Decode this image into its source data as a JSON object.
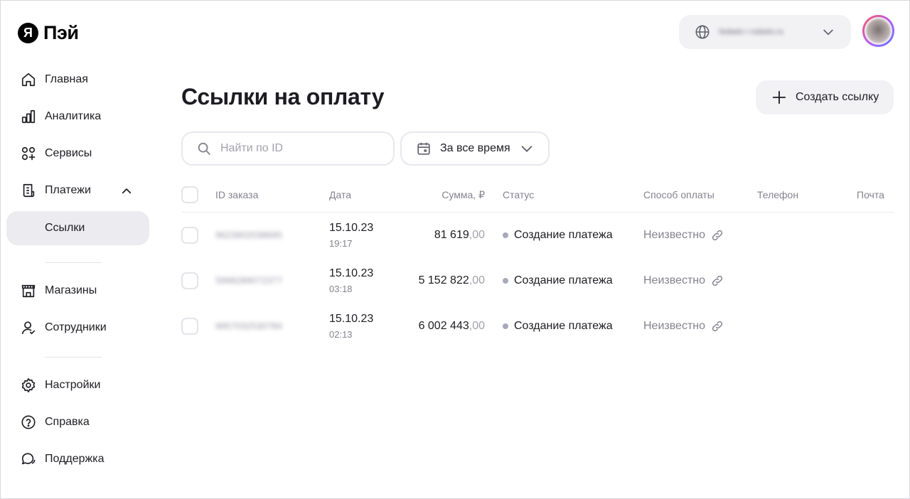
{
  "logo": {
    "mark": "Я",
    "text": "Пэй"
  },
  "sidebar": {
    "items": [
      {
        "label": "Главная",
        "icon": "home-icon"
      },
      {
        "label": "Аналитика",
        "icon": "analytics-icon"
      },
      {
        "label": "Сервисы",
        "icon": "services-icon"
      },
      {
        "label": "Платежи",
        "icon": "payments-icon",
        "expanded": true
      },
      {
        "label": "Ссылки",
        "selected": true
      },
      {
        "label": "Магазины",
        "icon": "shops-icon"
      },
      {
        "label": "Сотрудники",
        "icon": "employees-icon"
      },
      {
        "label": "Настройки",
        "icon": "settings-icon"
      },
      {
        "label": "Справка",
        "icon": "help-icon"
      },
      {
        "label": "Поддержка",
        "icon": "support-icon"
      }
    ]
  },
  "header": {
    "merchant_name": "Nobelo • nobelo.ru",
    "title": "Ссылки на оплату",
    "create_button": "Создать ссылку"
  },
  "filters": {
    "search_placeholder": "Найти по ID",
    "period": "За все время"
  },
  "table": {
    "columns": [
      "ID заказа",
      "Дата",
      "Сумма, ₽",
      "Статус",
      "Способ оплаты",
      "Телефон",
      "Почта"
    ],
    "rows": [
      {
        "order_id": "9623902038695",
        "date": "15.10.23",
        "time": "19:17",
        "amount_main": "81 619",
        "amount_kop": ",00",
        "status": "Создание платежа",
        "method": "Неизвестно",
        "phone": "",
        "email": ""
      },
      {
        "order_id": "5998289072377",
        "date": "15.10.23",
        "time": "03:18",
        "amount_main": "5 152 822",
        "amount_kop": ",00",
        "status": "Создание платежа",
        "method": "Неизвестно",
        "phone": "",
        "email": ""
      },
      {
        "order_id": "9957032530784",
        "date": "15.10.23",
        "time": "02:13",
        "amount_main": "6 002 443",
        "amount_kop": ",00",
        "status": "Создание платежа",
        "method": "Неизвестно",
        "phone": "",
        "email": ""
      }
    ]
  },
  "colors": {
    "text": "#1c1c22",
    "muted": "#83838f",
    "selected_bg": "#ebebf0",
    "button_bg": "#f2f2f5",
    "status_dot": "#a8a8bb"
  }
}
